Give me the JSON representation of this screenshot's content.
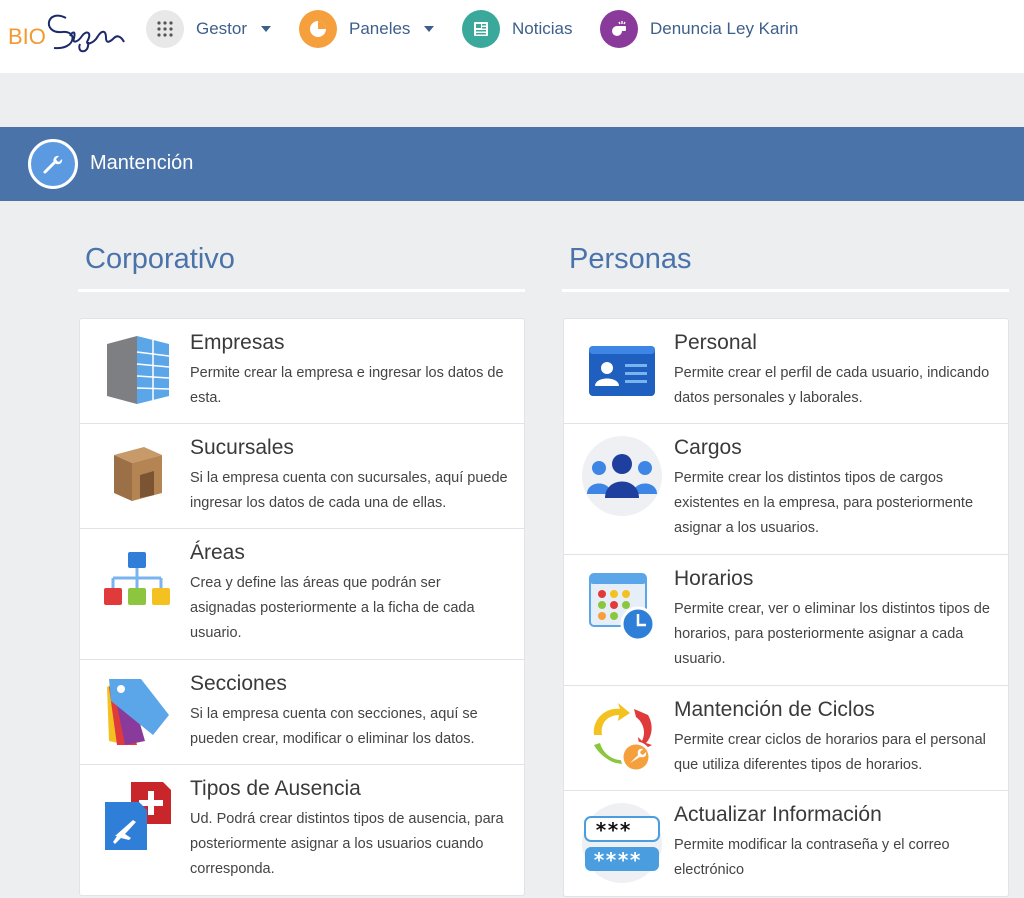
{
  "nav": {
    "logo_text": "BioSign",
    "items": [
      {
        "label": "Gestor",
        "icon": "grid-icon",
        "color": "#e8e8e8"
      },
      {
        "label": "Paneles",
        "icon": "pie-chart-icon",
        "color": "#f5a03c"
      },
      {
        "label": "Noticias",
        "icon": "newspaper-icon",
        "color": "#3aa89a"
      },
      {
        "label": "Denuncia Ley Karin",
        "icon": "whistle-icon",
        "color": "#8a3a9a"
      }
    ]
  },
  "section": {
    "title": "Mantención",
    "icon": "wrench-icon"
  },
  "columns": [
    {
      "title": "Corporativo",
      "cards": [
        {
          "title": "Empresas",
          "desc": "Permite crear la empresa e ingresar los datos de esta.",
          "icon": "building-icon"
        },
        {
          "title": "Sucursales",
          "desc": "Si la empresa cuenta con sucursales, aquí puede ingresar los datos de cada una de ellas.",
          "icon": "branch-box-icon"
        },
        {
          "title": "Áreas",
          "desc": "Crea y define las áreas que podrán ser asignadas posteriormente a la ficha de cada usuario.",
          "icon": "org-chart-icon"
        },
        {
          "title": "Secciones",
          "desc": "Si la empresa cuenta con secciones, aquí se pueden crear, modificar o eliminar los datos.",
          "icon": "tag-icon"
        },
        {
          "title": "Tipos de Ausencia",
          "desc": "Ud. Podrá crear distintos tipos de ausencia, para posteriormente asignar a los usuarios cuando corresponda.",
          "icon": "absence-icon"
        }
      ]
    },
    {
      "title": "Personas",
      "cards": [
        {
          "title": "Personal",
          "desc": "Permite crear el perfil de cada usuario, indicando datos personales y laborales.",
          "icon": "id-card-icon"
        },
        {
          "title": "Cargos",
          "desc": "Permite crear los distintos tipos de cargos existentes en la empresa, para posteriormente asignar a los usuarios.",
          "icon": "people-icon"
        },
        {
          "title": "Horarios",
          "desc": "Permite crear, ver o eliminar los distintos tipos de horarios, para posteriormente asignar a cada usuario.",
          "icon": "calendar-clock-icon"
        },
        {
          "title": "Mantención de Ciclos",
          "desc": "Permite crear ciclos de horarios para el personal que utiliza diferentes tipos de horarios.",
          "icon": "cycle-icon"
        },
        {
          "title": "Actualizar Información",
          "desc": "Permite modificar la contraseña y el correo electrónico",
          "icon": "password-icon"
        }
      ]
    }
  ]
}
